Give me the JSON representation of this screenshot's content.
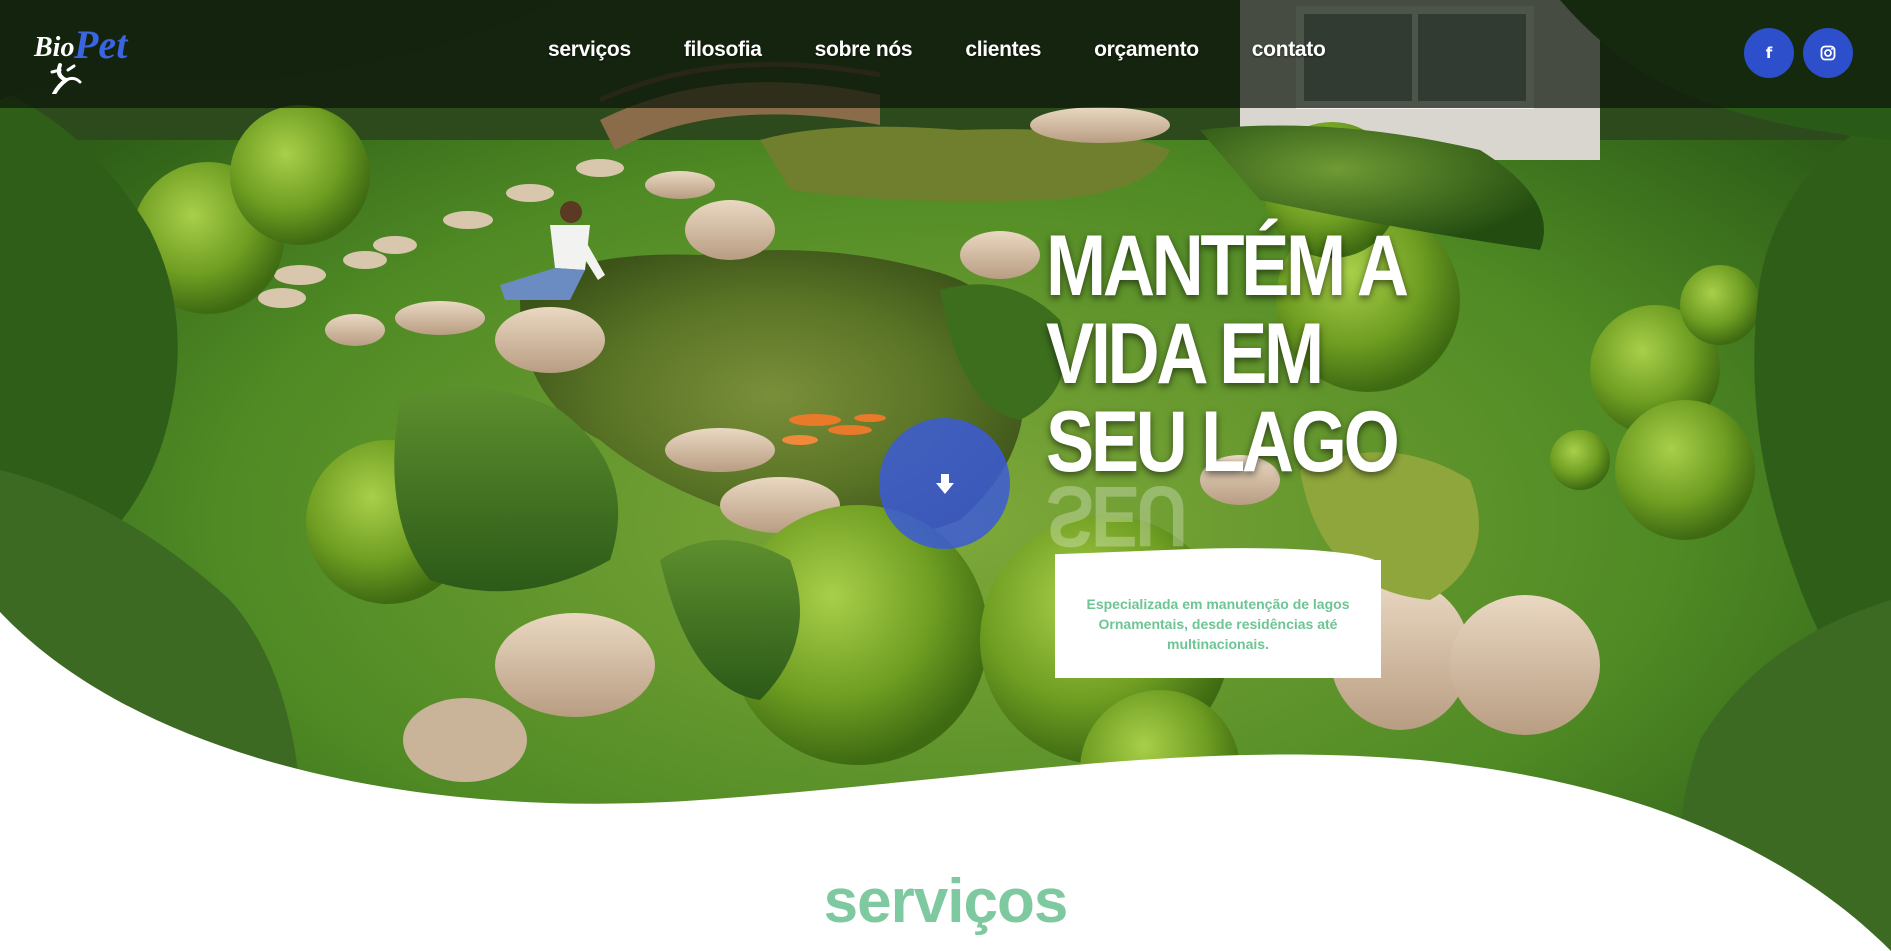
{
  "brand": {
    "logo_text_bio": "Bio",
    "logo_text_pet": "Pet"
  },
  "nav": {
    "items": [
      {
        "label": "serviços"
      },
      {
        "label": "filosofia"
      },
      {
        "label": "sobre nós"
      },
      {
        "label": "clientes"
      },
      {
        "label": "orçamento"
      },
      {
        "label": "contato"
      }
    ]
  },
  "social": {
    "facebook": {
      "glyph": "f",
      "icon": "facebook-icon"
    },
    "instagram": {
      "icon": "instagram-icon"
    }
  },
  "hero": {
    "headline_lines": [
      "MANTÉM A",
      "VIDA EM",
      "SEU LAGO"
    ],
    "reflection_text": "SEU",
    "scroll_icon": "arrow-down-icon",
    "tagline": "Especializada em manutenção de lagos Ornamentais, desde residências até multinacionais."
  },
  "section": {
    "title": "serviços"
  },
  "colors": {
    "accent_blue": "#2e4fcc",
    "accent_green": "#7ec99f",
    "tagline_green": "#6dc594",
    "header_overlay": "#0c160a"
  }
}
